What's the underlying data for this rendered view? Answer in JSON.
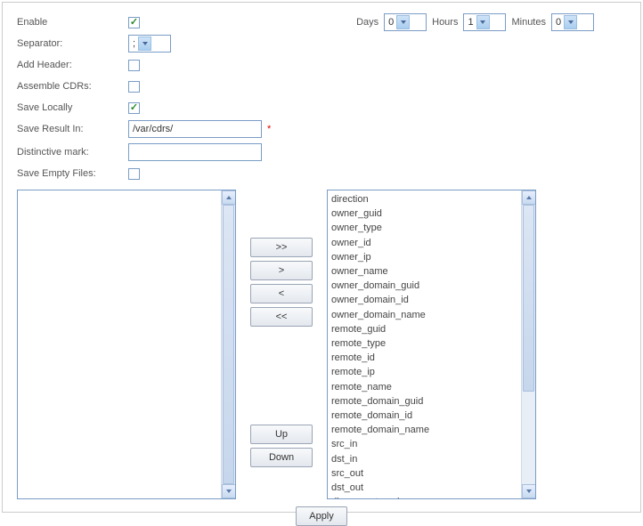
{
  "form": {
    "enable": {
      "label": "Enable",
      "checked": true
    },
    "separator": {
      "label": "Separator:",
      "value": ";"
    },
    "add_header": {
      "label": "Add Header:",
      "checked": false
    },
    "assemble_cdrs": {
      "label": "Assemble CDRs:",
      "checked": false
    },
    "save_locally": {
      "label": "Save Locally",
      "checked": true
    },
    "save_result_in": {
      "label": "Save Result In:",
      "value": "/var/cdrs/",
      "required": "*"
    },
    "distinctive_mark": {
      "label": "Distinctive mark:",
      "value": ""
    },
    "save_empty_files": {
      "label": "Save Empty Files:",
      "checked": false
    }
  },
  "time": {
    "days_label": "Days",
    "days_value": "0",
    "hours_label": "Hours",
    "hours_value": "1",
    "minutes_label": "Minutes",
    "minutes_value": "0"
  },
  "buttons": {
    "move_all_right": ">>",
    "move_right": ">",
    "move_left": "<",
    "move_all_left": "<<",
    "up": "Up",
    "down": "Down",
    "apply": "Apply"
  },
  "available_fields": [
    "direction",
    "owner_guid",
    "owner_type",
    "owner_id",
    "owner_ip",
    "owner_name",
    "owner_domain_guid",
    "owner_domain_id",
    "owner_domain_name",
    "remote_guid",
    "remote_type",
    "remote_id",
    "remote_ip",
    "remote_name",
    "remote_domain_guid",
    "remote_domain_id",
    "remote_domain_name",
    "src_in",
    "dst_in",
    "src_out",
    "dst_out",
    "disconnect_code"
  ],
  "selected_fields": []
}
